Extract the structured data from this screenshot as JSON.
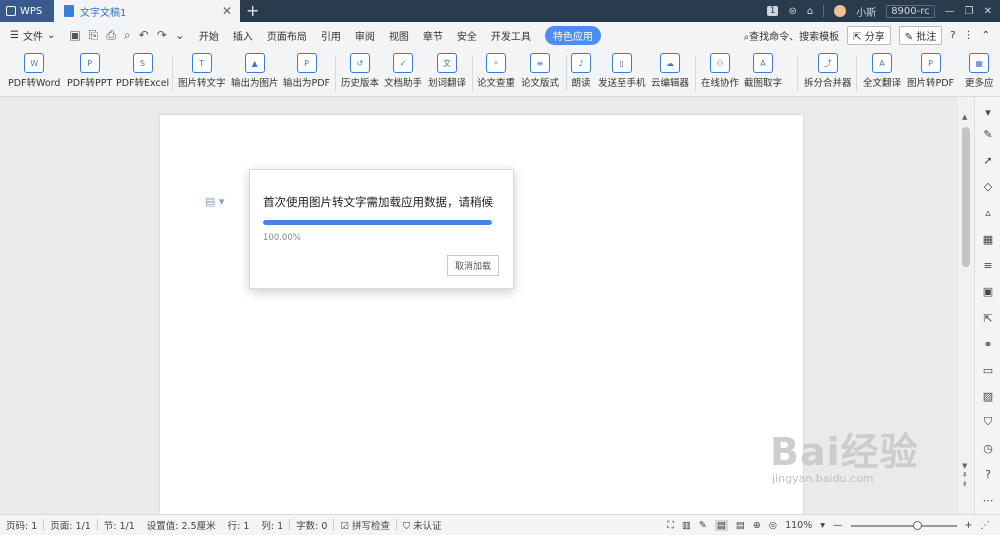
{
  "titlebar": {
    "app_tab": "WPS",
    "doc_tab": "文字文稿1",
    "badge": "1",
    "user": "小斯",
    "account": "8900-rc"
  },
  "menubar": {
    "file": "文件",
    "tabs": [
      "开始",
      "插入",
      "页面布局",
      "引用",
      "审阅",
      "视图",
      "章节",
      "安全",
      "开发工具",
      "特色应用"
    ],
    "active_tab": "特色应用",
    "search": "查找命令、搜索模板",
    "share": "分享",
    "comment": "批注"
  },
  "ribbon": {
    "items": [
      "PDF转Word",
      "PDF转PPT",
      "PDF转Excel",
      "图片转文字",
      "输出为图片",
      "输出为PDF",
      "历史版本",
      "文档助手",
      "划词翻译",
      "论文查重",
      "论文版式",
      "朗读",
      "发送至手机",
      "云编辑器",
      "在线协作",
      "截图取字",
      "拆分合并器",
      "全文翻译",
      "图片转PDF",
      "更多应"
    ]
  },
  "dialog": {
    "title": "首次使用图片转文字需加载应用数据，请稍候",
    "progress": 1.0,
    "progress_label": "100.00%",
    "cancel": "取消加载"
  },
  "statusbar": {
    "page_no": "页码: 1",
    "pages": "页面: 1/1",
    "section": "节: 1/1",
    "setting": "设置值: 2.5厘米",
    "row": "行: 1",
    "col": "列: 1",
    "words": "字数: 0",
    "spell": "拼写检查",
    "auth": "未认证",
    "zoom": "110%"
  },
  "watermark": {
    "logo": "Bai经验",
    "url": "jingyan.baidu.com"
  },
  "colors": {
    "accent": "#4a80e8",
    "titlebar": "#2b3b4e"
  }
}
